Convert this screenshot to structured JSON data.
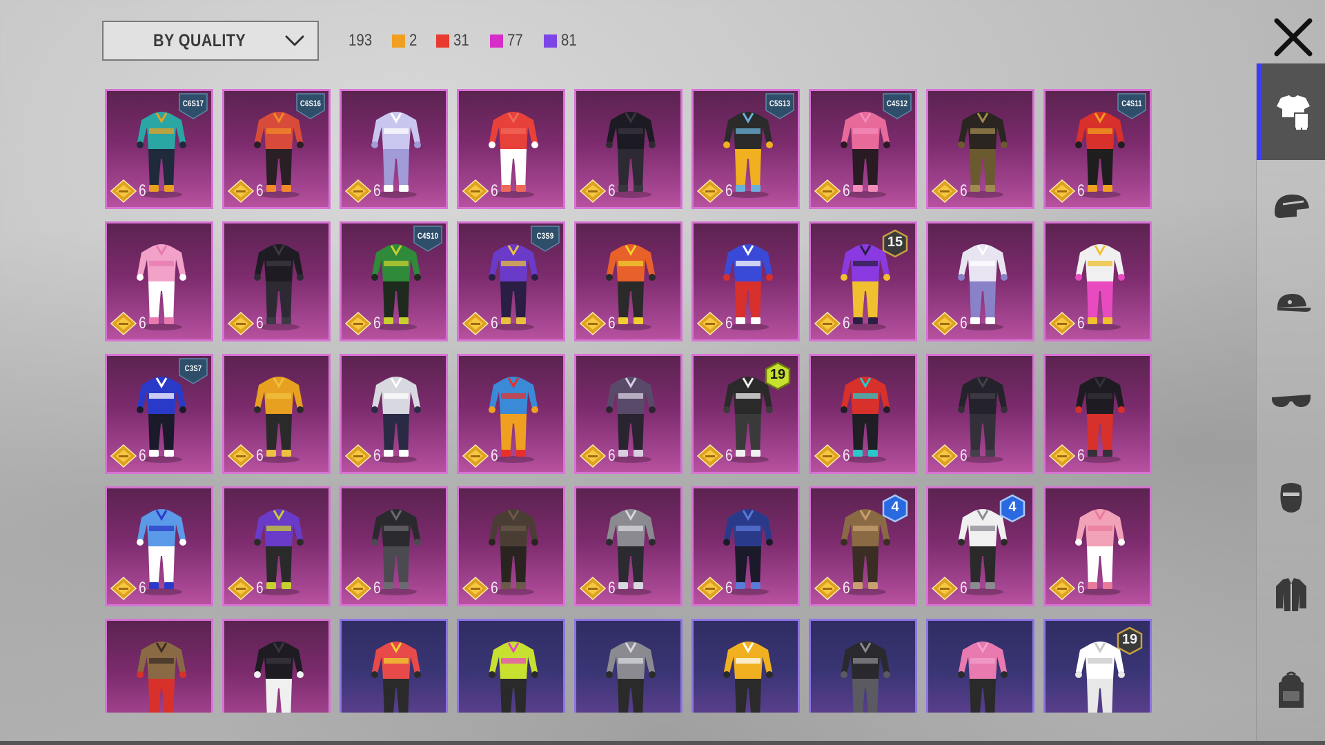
{
  "filter": {
    "label": "BY QUALITY"
  },
  "summary": {
    "total": "193",
    "counts": [
      {
        "value": "2",
        "color": "#f0a020"
      },
      {
        "value": "31",
        "color": "#e83a2f"
      },
      {
        "value": "77",
        "color": "#d62cc8"
      },
      {
        "value": "81",
        "color": "#7d45e8"
      }
    ]
  },
  "sidebar": {
    "tabs": [
      "outfit-icon",
      "helmet-icon",
      "cap-icon",
      "glasses-icon",
      "mask-icon",
      "jacket-icon",
      "backpack-icon"
    ],
    "active_index": 0
  },
  "colors": {
    "legendary_border": "#d773d5",
    "epic_border": "#8d74e3",
    "accent": "#3b3bff"
  },
  "items": [
    {
      "badge": "C6S17",
      "level": "",
      "grade": "6",
      "tier": "legendary",
      "c1": "#2aa6a4",
      "c2": "#1f2a3a",
      "c3": "#e8a020"
    },
    {
      "badge": "C6S16",
      "level": "",
      "grade": "6",
      "tier": "legendary",
      "c1": "#d84b3a",
      "c2": "#2a1f24",
      "c3": "#f28a2a"
    },
    {
      "badge": "",
      "level": "",
      "grade": "6",
      "tier": "legendary",
      "c1": "#c9c6f0",
      "c2": "#a19bd8",
      "c3": "#ffffff"
    },
    {
      "badge": "",
      "level": "",
      "grade": "6",
      "tier": "legendary",
      "c1": "#e8413a",
      "c2": "#ffffff",
      "c3": "#f06a5a"
    },
    {
      "badge": "",
      "level": "",
      "grade": "6",
      "tier": "legendary",
      "c1": "#1c1a22",
      "c2": "#2d2a33",
      "c3": "#3a3640"
    },
    {
      "badge": "C5S13",
      "level": "",
      "grade": "6",
      "tier": "legendary",
      "c1": "#2b2b2b",
      "c2": "#f0b020",
      "c3": "#6ab0d8"
    },
    {
      "badge": "C4S12",
      "level": "",
      "grade": "6",
      "tier": "legendary",
      "c1": "#e86a9a",
      "c2": "#2a1a24",
      "c3": "#f28cba"
    },
    {
      "badge": "",
      "level": "",
      "grade": "6",
      "tier": "legendary",
      "c1": "#2a2520",
      "c2": "#6b5a30",
      "c3": "#a08a50"
    },
    {
      "badge": "C4S11",
      "level": "",
      "grade": "6",
      "tier": "legendary",
      "c1": "#d8302a",
      "c2": "#1e1e1e",
      "c3": "#f0a020"
    },
    {
      "badge": "",
      "level": "",
      "grade": "6",
      "tier": "legendary",
      "c1": "#f2a2c8",
      "c2": "#ffffff",
      "c3": "#e87ab0"
    },
    {
      "badge": "",
      "level": "",
      "grade": "6",
      "tier": "legendary",
      "c1": "#1e1c22",
      "c2": "#2e2a34",
      "c3": "#3c3844"
    },
    {
      "badge": "C4S10",
      "level": "",
      "grade": "6",
      "tier": "legendary",
      "c1": "#2f8a3a",
      "c2": "#1e2a1e",
      "c3": "#c8d030"
    },
    {
      "badge": "C3S9",
      "level": "",
      "grade": "6",
      "tier": "legendary",
      "c1": "#6a3ac8",
      "c2": "#2a1e44",
      "c3": "#e8c040"
    },
    {
      "badge": "",
      "level": "",
      "grade": "6",
      "tier": "legendary",
      "c1": "#e8602a",
      "c2": "#2a2a2a",
      "c3": "#f0d030"
    },
    {
      "badge": "",
      "level": "",
      "grade": "6",
      "tier": "legendary",
      "c1": "#3a4ad8",
      "c2": "#d8302a",
      "c3": "#ffffff"
    },
    {
      "badge": "",
      "level": "15",
      "grade": "6",
      "tier": "legendary",
      "c1": "#8a3ae0",
      "c2": "#f0c030",
      "c3": "#2a1e44"
    },
    {
      "badge": "",
      "level": "",
      "grade": "6",
      "tier": "legendary",
      "c1": "#e8e4f2",
      "c2": "#8a82c8",
      "c3": "#ffffff"
    },
    {
      "badge": "",
      "level": "",
      "grade": "6",
      "tier": "legendary",
      "c1": "#f0f0f0",
      "c2": "#e84ac0",
      "c3": "#f0c030"
    },
    {
      "badge": "C3S7",
      "level": "",
      "grade": "6",
      "tier": "legendary",
      "c1": "#2a3ac8",
      "c2": "#1a1a2a",
      "c3": "#ffffff"
    },
    {
      "badge": "",
      "level": "",
      "grade": "6",
      "tier": "legendary",
      "c1": "#e8a020",
      "c2": "#2a2a2a",
      "c3": "#f0c040"
    },
    {
      "badge": "",
      "level": "",
      "grade": "6",
      "tier": "legendary",
      "c1": "#d8d8e0",
      "c2": "#2a2a44",
      "c3": "#ffffff"
    },
    {
      "badge": "",
      "level": "",
      "grade": "6",
      "tier": "legendary",
      "c1": "#3a8ad8",
      "c2": "#f0a020",
      "c3": "#e8302a"
    },
    {
      "badge": "",
      "level": "",
      "grade": "6",
      "tier": "legendary",
      "c1": "#5a4a6a",
      "c2": "#2a2430",
      "c3": "#d8d0e0"
    },
    {
      "badge": "",
      "level": "19",
      "grade": "6",
      "tier": "legendary",
      "c1": "#2a2a2a",
      "c2": "#3a3a3a",
      "c3": "#f0f0f0"
    },
    {
      "badge": "",
      "level": "",
      "grade": "6",
      "tier": "legendary",
      "c1": "#d8302a",
      "c2": "#1e1e24",
      "c3": "#2ac8c8"
    },
    {
      "badge": "",
      "level": "",
      "grade": "6",
      "tier": "legendary",
      "c1": "#24222a",
      "c2": "#34303a",
      "c3": "#44404c"
    },
    {
      "badge": "",
      "level": "",
      "grade": "6",
      "tier": "legendary",
      "c1": "#1e1c22",
      "c2": "#d8302a",
      "c3": "#34303a"
    },
    {
      "badge": "",
      "level": "",
      "grade": "6",
      "tier": "legendary",
      "c1": "#5a9ae8",
      "c2": "#ffffff",
      "c3": "#2a3ac8"
    },
    {
      "badge": "",
      "level": "",
      "grade": "6",
      "tier": "legendary",
      "c1": "#6a3ac8",
      "c2": "#2a2a2a",
      "c3": "#c8d030"
    },
    {
      "badge": "",
      "level": "",
      "grade": "6",
      "tier": "legendary",
      "c1": "#2a2a2e",
      "c2": "#4a4a50",
      "c3": "#6a6a70"
    },
    {
      "badge": "",
      "level": "",
      "grade": "6",
      "tier": "legendary",
      "c1": "#4a3e34",
      "c2": "#2a2420",
      "c3": "#6a5a48"
    },
    {
      "badge": "",
      "level": "",
      "grade": "6",
      "tier": "legendary",
      "c1": "#8a8a90",
      "c2": "#2a2a30",
      "c3": "#d8d8e0"
    },
    {
      "badge": "",
      "level": "",
      "grade": "6",
      "tier": "legendary",
      "c1": "#2a3a8a",
      "c2": "#1a1a2a",
      "c3": "#5a7ad8"
    },
    {
      "badge": "",
      "level": "4",
      "grade": "6",
      "tier": "legendary",
      "c1": "#8a6a44",
      "c2": "#3a2e24",
      "c3": "#c8a070"
    },
    {
      "badge": "",
      "level": "4",
      "grade": "6",
      "tier": "legendary",
      "c1": "#f0f0f0",
      "c2": "#2a2a2a",
      "c3": "#8a8a90"
    },
    {
      "badge": "",
      "level": "",
      "grade": "6",
      "tier": "legendary",
      "c1": "#f2a2b8",
      "c2": "#ffffff",
      "c3": "#e87a9a"
    },
    {
      "badge": "",
      "level": "",
      "grade": "",
      "tier": "legendary",
      "c1": "#8a6a44",
      "c2": "#d8302a",
      "c3": "#3a2e24"
    },
    {
      "badge": "",
      "level": "",
      "grade": "",
      "tier": "legendary",
      "c1": "#1e1c22",
      "c2": "#f0f0f0",
      "c3": "#3a3640"
    },
    {
      "badge": "",
      "level": "",
      "grade": "",
      "tier": "epic",
      "c1": "#e84a4a",
      "c2": "#2a2a2a",
      "c3": "#f0d030"
    },
    {
      "badge": "",
      "level": "",
      "grade": "",
      "tier": "epic",
      "c1": "#c8e030",
      "c2": "#2a2a2a",
      "c3": "#e84ac0"
    },
    {
      "badge": "",
      "level": "",
      "grade": "",
      "tier": "epic",
      "c1": "#8a8a90",
      "c2": "#2a2a2a",
      "c3": "#d8d8e0"
    },
    {
      "badge": "",
      "level": "",
      "grade": "",
      "tier": "epic",
      "c1": "#f0b020",
      "c2": "#2a2a2a",
      "c3": "#ffffff"
    },
    {
      "badge": "",
      "level": "",
      "grade": "",
      "tier": "epic",
      "c1": "#2a2a2e",
      "c2": "#5a5a60",
      "c3": "#8a8a90"
    },
    {
      "badge": "",
      "level": "",
      "grade": "",
      "tier": "epic",
      "c1": "#e87ab0",
      "c2": "#2a2a2a",
      "c3": "#f2a2c8"
    },
    {
      "badge": "",
      "level": "19",
      "grade": "",
      "tier": "epic",
      "c1": "#ffffff",
      "c2": "#e8e8e8",
      "c3": "#c8c8c8"
    }
  ]
}
